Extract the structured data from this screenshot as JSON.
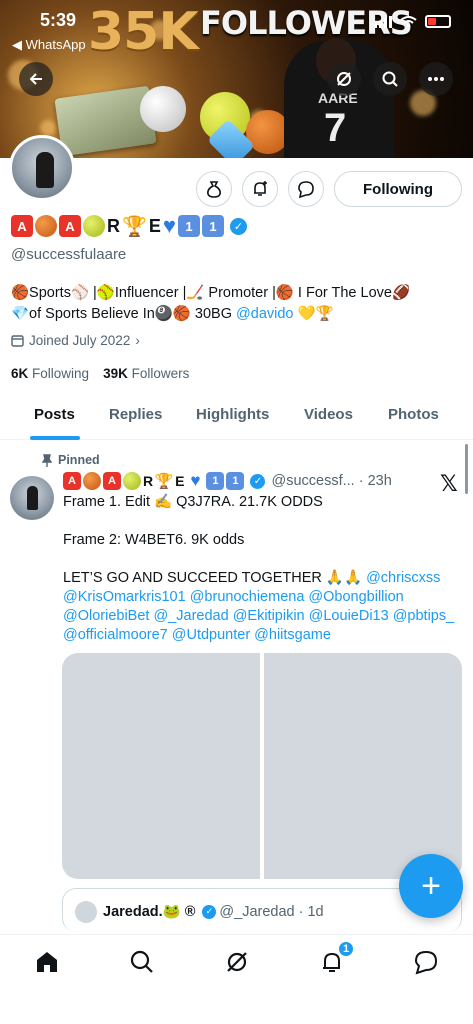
{
  "status_bar": {
    "time": "5:39",
    "back_label": "◀ WhatsApp"
  },
  "banner": {
    "headline_number": "35K",
    "headline_text": "FOLLOWERS",
    "jersey_name": "AARE",
    "jersey_number": "7"
  },
  "profile": {
    "display_name_suffix": "E",
    "handle": "@successfulaare",
    "bio_line1_a": "🏀Sports⚾️ |🥎Influencer |🏒  Promoter |🏀 I For The Love🏈",
    "bio_line2_a": "💎of Sports Believe In🎱🏀 30BG ",
    "bio_line2_link": "@davido",
    "bio_line2_b": " 💛🏆",
    "joined": "Joined July 2022",
    "following_count": "6K",
    "following_label": "Following",
    "followers_count": "39K",
    "followers_label": "Followers",
    "follow_button": "Following"
  },
  "tabs": [
    "Posts",
    "Replies",
    "Highlights",
    "Videos",
    "Photos"
  ],
  "post": {
    "pinned_label": "Pinned",
    "handle_time": "@successf... · 23h",
    "line1": "Frame 1. Edit ✍️ Q3J7RA.  21.7K ODDS",
    "line2": "Frame 2: W4BET6.  9K odds",
    "line3_a": "LET’S GO AND SUCCEED TOGETHER 🙏🙏 ",
    "mentions": "@chriscxss @KrisOmarkris101 @brunochiemena @Obongbillion @OloriebiBet @_Jaredad @Ekitipikin @LouieDi13 @pbtips_ @officialmoore7 @Utdpunter @hiitsgame"
  },
  "quote": {
    "name": "Jaredad.🐸 ®",
    "handle_time": "@_Jaredad · 1d"
  },
  "fab_label": "+",
  "nav": {
    "notifications_badge": "1"
  },
  "colors": {
    "accent": "#1d9bf0",
    "text": "#0f1419",
    "muted": "#536471"
  }
}
